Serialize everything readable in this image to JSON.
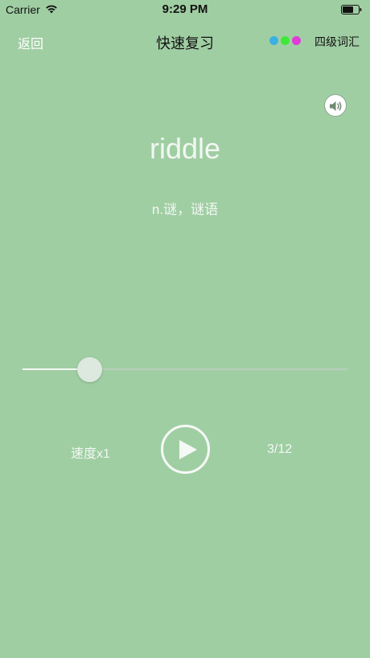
{
  "status_bar": {
    "carrier": "Carrier",
    "time": "9:29 PM",
    "wifi_icon": "wifi-icon",
    "battery_icon": "battery-icon"
  },
  "nav": {
    "back_label": "返回",
    "title": "快速复习",
    "vocab_label": "四级词汇",
    "color_dots": [
      "#3ab0e0",
      "#3ee83a",
      "#e03ad8"
    ]
  },
  "card": {
    "speaker_icon": "speaker-icon",
    "word": "riddle",
    "definition": "n.谜，谜语"
  },
  "player": {
    "progress_fraction": 0.205,
    "speed_label": "速度x1",
    "play_icon": "play-icon",
    "count": "3/12"
  }
}
